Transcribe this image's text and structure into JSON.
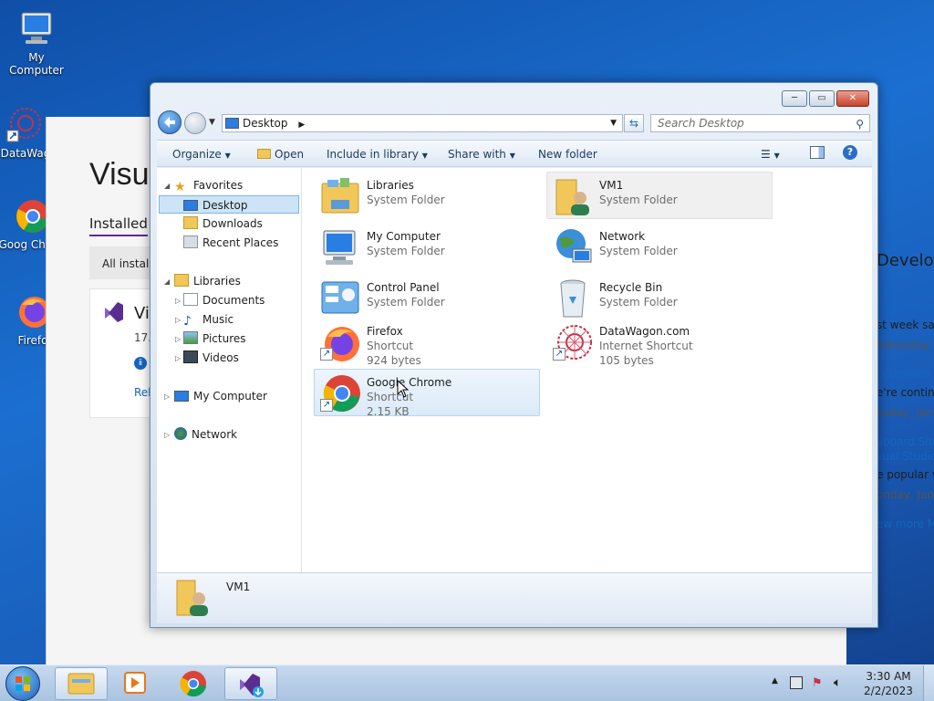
{
  "desktop": {
    "icons": [
      {
        "label": "My Computer",
        "icon": "computer-icon"
      },
      {
        "label": "DataWag",
        "icon": "datawagon-icon"
      },
      {
        "label": "Goog Chron",
        "icon": "chrome-icon"
      },
      {
        "label": "Firefo",
        "icon": "firefox-icon"
      }
    ]
  },
  "background_app": {
    "title": "Visu",
    "tab": "Installed",
    "filter": "All installa",
    "product_short": "Vi",
    "product_version": "17.",
    "product_link": "Rel",
    "news_heading": "Develope",
    "news": [
      {
        "link": "troducing th",
        "link2": "nprovement",
        "text": "st week saw",
        "date": "ednesday, J"
      },
      {
        "link": "ocuments a",
        "text": "e're continu",
        "date": "esday, Janu"
      },
      {
        "link": "yboard Sho",
        "link2": "sual Studio",
        "text": "e popular v",
        "date": "onday, Janu"
      }
    ],
    "more": "ew more Mi"
  },
  "window": {
    "controls": {
      "min": "─",
      "max": "▭",
      "close": "✕"
    },
    "address": "Desktop",
    "search_placeholder": "Search Desktop",
    "toolbar": {
      "organize": "Organize",
      "open": "Open",
      "include": "Include in library",
      "share": "Share with",
      "new_folder": "New folder"
    },
    "nav": {
      "favorites": "Favorites",
      "desktop": "Desktop",
      "downloads": "Downloads",
      "recent": "Recent Places",
      "libraries": "Libraries",
      "documents": "Documents",
      "music": "Music",
      "pictures": "Pictures",
      "videos": "Videos",
      "computer": "My Computer",
      "network": "Network"
    },
    "items": [
      {
        "name": "Libraries",
        "type": "System Folder",
        "size": ""
      },
      {
        "name": "VM1",
        "type": "System Folder",
        "size": ""
      },
      {
        "name": "My Computer",
        "type": "System Folder",
        "size": ""
      },
      {
        "name": "Network",
        "type": "System Folder",
        "size": ""
      },
      {
        "name": "Control Panel",
        "type": "System Folder",
        "size": ""
      },
      {
        "name": "Recycle Bin",
        "type": "System Folder",
        "size": ""
      },
      {
        "name": "Firefox",
        "type": "Shortcut",
        "size": "924 bytes"
      },
      {
        "name": "DataWagon.com",
        "type": "Internet Shortcut",
        "size": "105 bytes"
      },
      {
        "name": "Google Chrome",
        "type": "Shortcut",
        "size": "2.15 KB"
      }
    ],
    "details_name": "VM1"
  },
  "taskbar": {
    "time": "3:30 AM",
    "date": "2/2/2023"
  }
}
